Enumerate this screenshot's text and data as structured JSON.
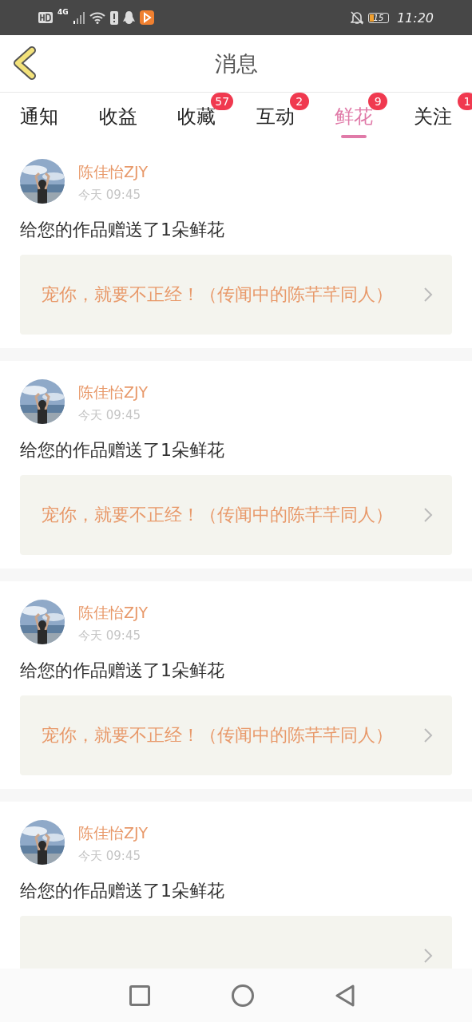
{
  "status_bar": {
    "network": "4G",
    "battery": "15",
    "time": "11:20"
  },
  "header": {
    "title": "消息"
  },
  "tabs": [
    {
      "label": "通知",
      "selected": false
    },
    {
      "label": "收益",
      "selected": false
    },
    {
      "label": "收藏",
      "selected": false,
      "badge": "57"
    },
    {
      "label": "互动",
      "selected": false,
      "badge": "2"
    },
    {
      "label": "鲜花",
      "selected": true,
      "badge": "9"
    },
    {
      "label": "关注",
      "selected": false,
      "badge": "1"
    }
  ],
  "messages": [
    {
      "user": "陈佳怡ZJY",
      "time": "今天 09:45",
      "text": "给您的作品赠送了1朵鲜花",
      "work": "宠你，就要不正经！（传闻中的陈芊芊同人）"
    },
    {
      "user": "陈佳怡ZJY",
      "time": "今天 09:45",
      "text": "给您的作品赠送了1朵鲜花",
      "work": "宠你，就要不正经！（传闻中的陈芊芊同人）"
    },
    {
      "user": "陈佳怡ZJY",
      "time": "今天 09:45",
      "text": "给您的作品赠送了1朵鲜花",
      "work": "宠你，就要不正经！（传闻中的陈芊芊同人）"
    },
    {
      "user": "陈佳怡ZJY",
      "time": "今天 09:45",
      "text": "给您的作品赠送了1朵鲜花"
    }
  ]
}
